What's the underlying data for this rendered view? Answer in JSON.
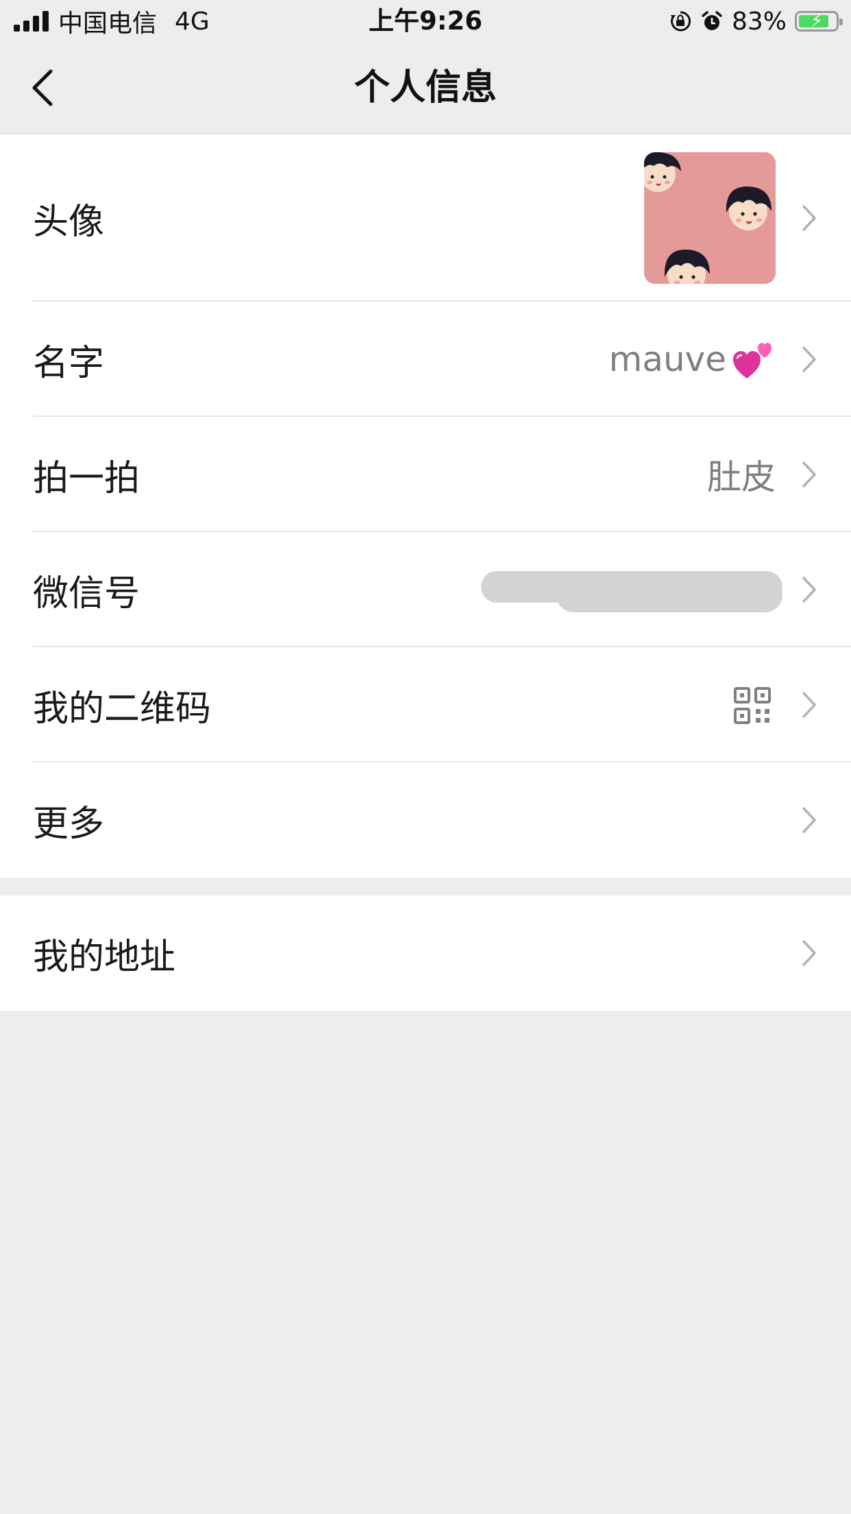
{
  "status_bar": {
    "carrier": "中国电信",
    "network": "4G",
    "time": "上午9:26",
    "battery": "83%",
    "battery_level": 0.83,
    "icons": [
      "signal-icon",
      "rotation-lock-icon",
      "alarm-icon",
      "battery-charging-icon"
    ]
  },
  "nav": {
    "title": "个人信息",
    "back_icon": "chevron-left-icon"
  },
  "profile": {
    "avatar": {
      "label": "头像",
      "icon": "avatar-image"
    },
    "name": {
      "label": "名字",
      "value": "mauve",
      "emoji_icon": "two-hearts-icon"
    },
    "pat": {
      "label": "拍一拍",
      "value": "肚皮"
    },
    "wechat_id": {
      "label": "微信号",
      "value_state": "redacted"
    },
    "qr_code": {
      "label": "我的二维码",
      "icon": "qr-code-icon"
    },
    "more": {
      "label": "更多"
    }
  },
  "address": {
    "label": "我的地址"
  },
  "colors": {
    "background": "#ededed",
    "card": "#ffffff",
    "text_primary": "#1a1a1a",
    "text_secondary": "#7f7f7f",
    "chevron": "#b2b2b2",
    "avatar_bg": "#e59a9a",
    "battery_green": "#4cd964"
  }
}
